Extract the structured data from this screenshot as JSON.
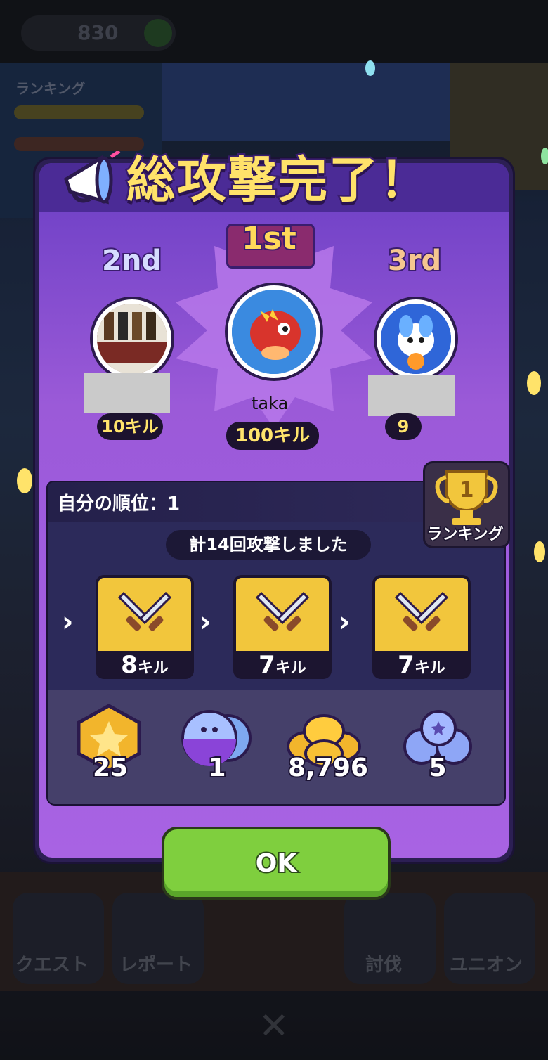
{
  "background": {
    "currency_count": "830",
    "ranking_tab": "ランキング",
    "bottom_labels": [
      "クエスト",
      "レポート",
      "討伐",
      "ユニオン"
    ]
  },
  "dialog": {
    "title": "総攻撃完了！",
    "podium": {
      "first": {
        "rank": "1st",
        "name": "taka",
        "kills": "100キル"
      },
      "second": {
        "rank": "2nd",
        "kills": "10キル"
      },
      "third": {
        "rank": "3rd",
        "kills": "9"
      }
    },
    "self_rank": "自分の順位：1",
    "ranking_button": {
      "rank_number": "1",
      "label": "ランキング"
    },
    "attack_summary": "計14回攻撃しました",
    "attacks": [
      {
        "count": "8",
        "unit": "キル"
      },
      {
        "count": "7",
        "unit": "キル"
      },
      {
        "count": "7",
        "unit": "キル"
      }
    ],
    "rewards": [
      {
        "icon": "star-medal-icon",
        "amount": "25"
      },
      {
        "icon": "capsule-icon",
        "amount": "1"
      },
      {
        "icon": "gold-coins-icon",
        "amount": "8,796"
      },
      {
        "icon": "blue-orbs-icon",
        "amount": "5"
      }
    ],
    "ok_label": "OK"
  },
  "colors": {
    "accent_yellow": "#ffe26a",
    "panel_purple": "#9b5ad8",
    "ok_green": "#7fcf3e"
  }
}
